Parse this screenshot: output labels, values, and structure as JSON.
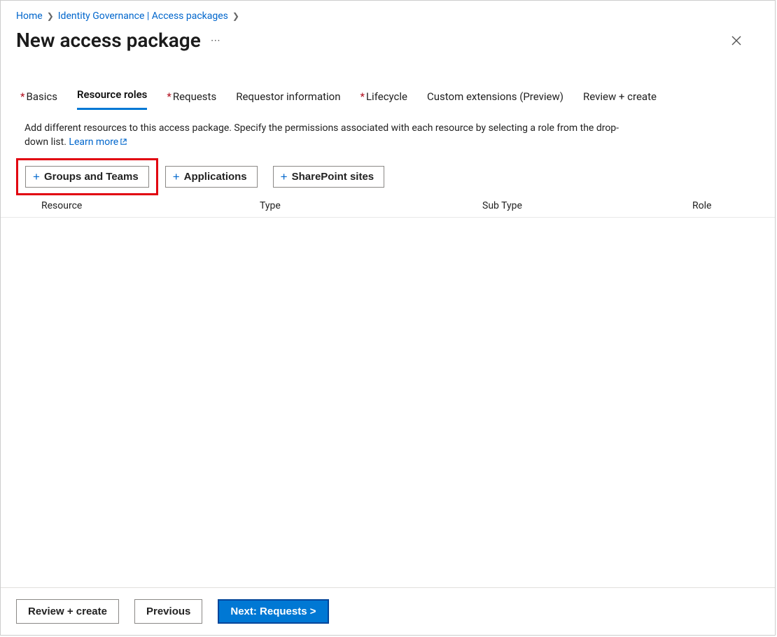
{
  "breadcrumb": {
    "home": "Home",
    "parent": "Identity Governance | Access packages"
  },
  "page_title": "New access package",
  "tabs": [
    {
      "label": "Basics",
      "required": true,
      "active": false
    },
    {
      "label": "Resource roles",
      "required": false,
      "active": true
    },
    {
      "label": "Requests",
      "required": true,
      "active": false
    },
    {
      "label": "Requestor information",
      "required": false,
      "active": false
    },
    {
      "label": "Lifecycle",
      "required": true,
      "active": false
    },
    {
      "label": "Custom extensions (Preview)",
      "required": false,
      "active": false
    },
    {
      "label": "Review + create",
      "required": false,
      "active": false
    }
  ],
  "description": "Add different resources to this access package. Specify the permissions associated with each resource by selecting a role from the drop-down list.",
  "learn_more_label": "Learn more",
  "resource_buttons": [
    {
      "label": "Groups and Teams",
      "highlighted": true
    },
    {
      "label": "Applications",
      "highlighted": false
    },
    {
      "label": "SharePoint sites",
      "highlighted": false
    }
  ],
  "table": {
    "columns": {
      "resource": "Resource",
      "type": "Type",
      "subtype": "Sub Type",
      "role": "Role"
    },
    "rows": []
  },
  "footer": {
    "review_create": "Review + create",
    "previous": "Previous",
    "next": "Next: Requests >"
  }
}
